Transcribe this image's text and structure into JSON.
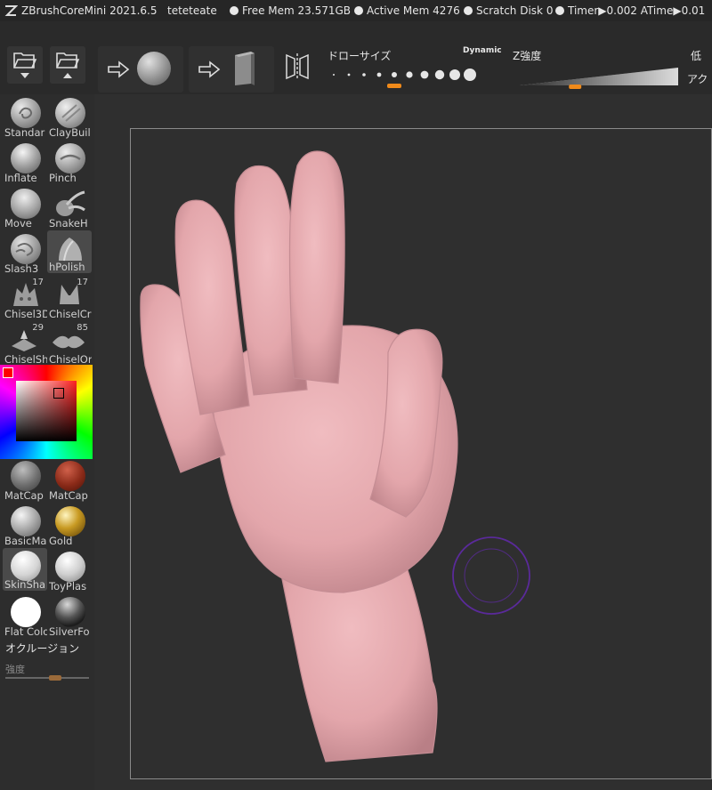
{
  "titlebar": {
    "app": "ZBrushCoreMini 2021.6.5",
    "user": "teteteate",
    "free_mem": "Free Mem 23.571GB",
    "active_mem": "Active Mem 4276",
    "scratch": "Scratch Disk 0",
    "timer": "Timer▶0.002 ATime▶0.01"
  },
  "toolbar": {
    "draw_size_label": "ドローサイズ",
    "dynamic_label": "Dynamic",
    "z_label": "Z強度",
    "low_label": "低",
    "act_label": "アク",
    "draw_size_selected": 4,
    "z_intensity": 0.28
  },
  "brushes": [
    {
      "label": "Standar"
    },
    {
      "label": "ClayBuil"
    },
    {
      "label": "Inflate"
    },
    {
      "label": "Pinch"
    },
    {
      "label": "Move"
    },
    {
      "label": "SnakeH"
    },
    {
      "label": "Slash3"
    },
    {
      "label": "hPolish"
    },
    {
      "label": "Chisel3D",
      "num": "17"
    },
    {
      "label": "ChiselCr",
      "num": "17"
    },
    {
      "label": "ChiselSh",
      "num": "29"
    },
    {
      "label": "ChiselOr",
      "num": "85"
    }
  ],
  "materials": [
    {
      "label": "MatCap"
    },
    {
      "label": "MatCap"
    },
    {
      "label": "BasicMa"
    },
    {
      "label": "Gold"
    },
    {
      "label": "SkinSha"
    },
    {
      "label": "ToyPlas"
    },
    {
      "label": "Flat Colo"
    },
    {
      "label": "SilverFo"
    }
  ],
  "occlusion": {
    "label": "オクルージョン",
    "strength_label": "強度",
    "value": 0.6
  },
  "colors": {
    "model": "#e3a6ab",
    "brush_ring": "#5a2a9a",
    "accent": "#f08a1a"
  }
}
